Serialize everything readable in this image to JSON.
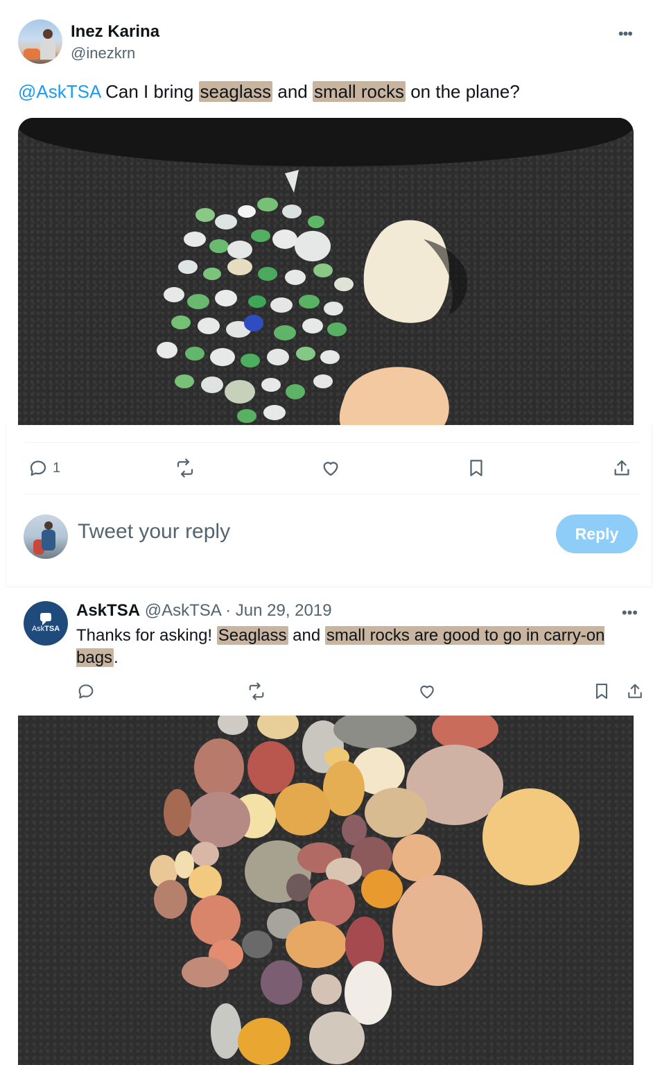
{
  "tweet": {
    "author_name": "Inez Karina",
    "author_handle": "@inezkrn",
    "more_icon": "more-horizontal-icon",
    "text_parts": {
      "mention": "@AskTSA",
      "t1": " Can I bring ",
      "h1": "seaglass",
      "t2": " and ",
      "h2": "small rocks",
      "t3": " on the plane?"
    },
    "actions": {
      "reply_count": "1",
      "icons": [
        "reply-icon",
        "retweet-icon",
        "like-icon",
        "bookmark-icon",
        "share-icon"
      ]
    }
  },
  "compose": {
    "placeholder": "Tweet your reply",
    "button_label": "Reply"
  },
  "reply": {
    "author_name": "AskTSA",
    "author_handle": "@AskTSA",
    "separator": " · ",
    "date": "Jun 29, 2019",
    "avatar_text_a": "Ask",
    "avatar_text_b": "TSA",
    "text_parts": {
      "t1": "Thanks for asking! ",
      "h1": "Seaglass",
      "t2": " and ",
      "h2": "small rocks are good to go in carry-on bags",
      "t3": "."
    }
  },
  "colors": {
    "accent": "#1d9bf0",
    "highlight": "#c8b49f",
    "reply_button": "#8ecdf8",
    "muted_text": "#536471"
  }
}
